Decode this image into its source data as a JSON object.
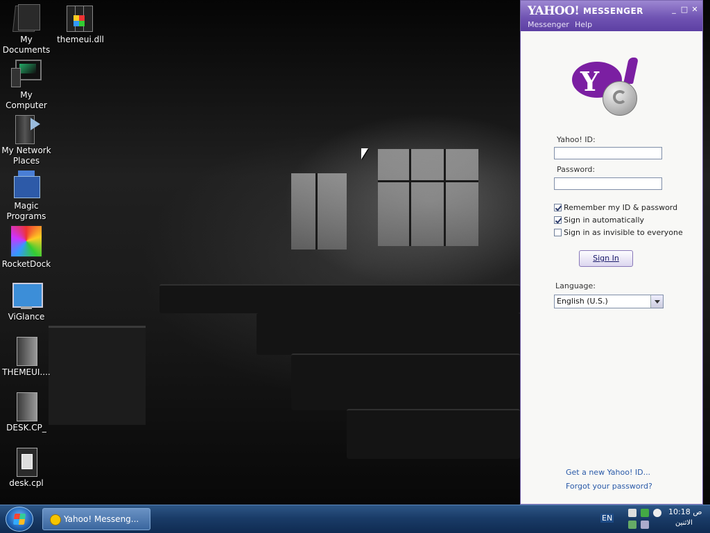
{
  "desktop": {
    "icons": [
      {
        "label": "My Documents"
      },
      {
        "label": "themeui.dll"
      },
      {
        "label": "My Computer"
      },
      {
        "label": "My Network Places"
      },
      {
        "label": "Magic Programs"
      },
      {
        "label": "RocketDock"
      },
      {
        "label": "ViGlance"
      },
      {
        "label": "THEMEUI...."
      },
      {
        "label": "DESK.CP_"
      },
      {
        "label": "desk.cpl"
      }
    ]
  },
  "messenger": {
    "logo_text": "YAHOO!",
    "title": "MESSENGER",
    "controls": {
      "minimize": "_",
      "maximize": "□",
      "close": "✕"
    },
    "menu": [
      "Messenger",
      "Help"
    ],
    "yahoo_id_label": "Yahoo! ID:",
    "yahoo_id_value": "",
    "password_label": "Password:",
    "password_value": "",
    "options": [
      {
        "label": "Remember my ID & password",
        "checked": true
      },
      {
        "label": "Sign in automatically",
        "checked": true
      },
      {
        "label": "Sign in as invisible to everyone",
        "checked": false
      }
    ],
    "sign_in_label": "Sign In",
    "language_label": "Language:",
    "language_value": "English (U.S.)",
    "links": {
      "new_id": "Get a new Yahoo! ID...",
      "forgot": "Forgot your password?"
    },
    "brand_color": "#7b1fa2"
  },
  "taskbar": {
    "task_label": "Yahoo! Messeng...",
    "language": "EN",
    "clock_time": "10:18 ص",
    "clock_day": "الاثنين",
    "color": "#1a3c68"
  },
  "icons": [
    "windows-flag-icon",
    "yahoo-smiley-icon",
    "volume-icon",
    "network-icon",
    "messenger-tray-icon"
  ]
}
